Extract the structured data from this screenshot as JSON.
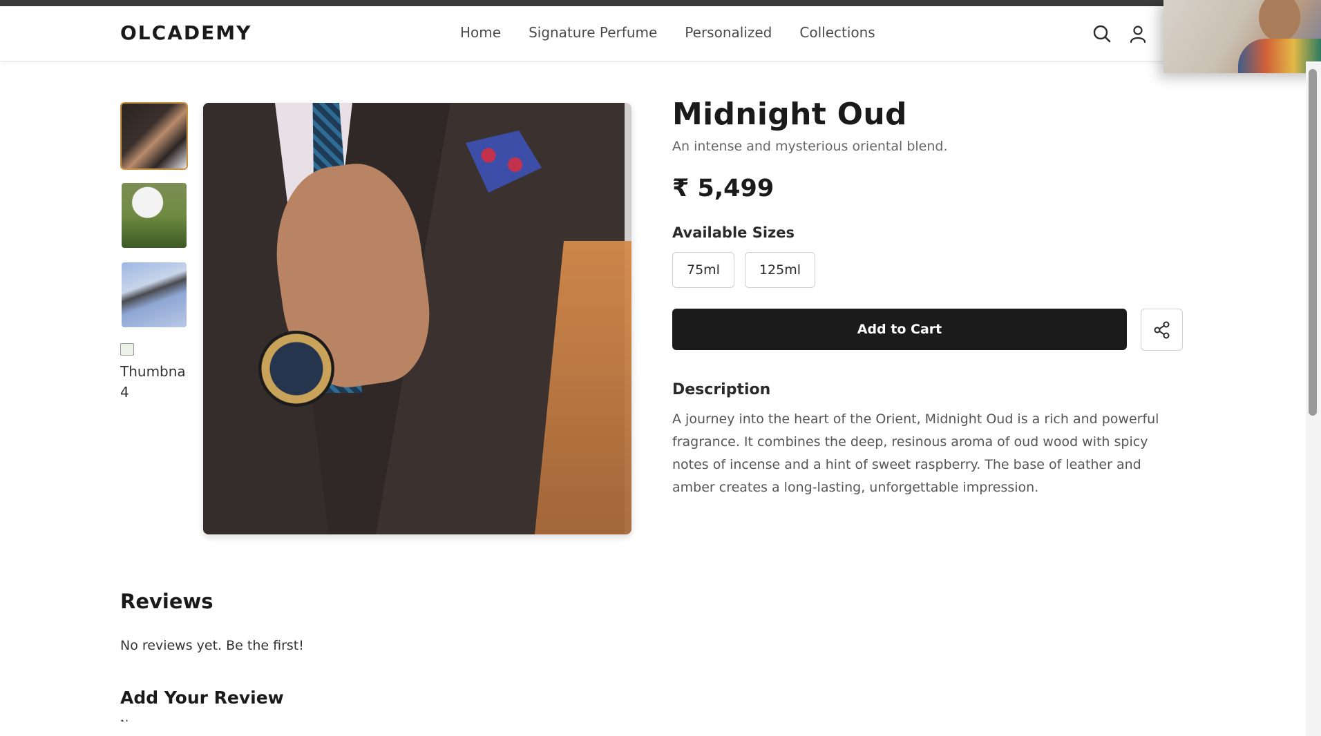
{
  "header": {
    "logo": "OLCADEMY",
    "nav": [
      "Home",
      "Signature Perfume",
      "Personalized",
      "Collections"
    ],
    "icons": [
      "search-icon",
      "user-icon"
    ]
  },
  "gallery": {
    "thumbnails": [
      "thumbnail-1",
      "thumbnail-2",
      "thumbnail-3"
    ],
    "broken_thumbnail_alt": "Thumbna 4"
  },
  "product": {
    "name": "Midnight Oud",
    "tagline": "An intense and mysterious oriental blend.",
    "price": "₹ 5,499",
    "sizes_label": "Available Sizes",
    "sizes": [
      "75ml",
      "125ml"
    ],
    "add_to_cart": "Add to Cart",
    "description_title": "Description",
    "description": "A journey into the heart of the Orient, Midnight Oud is a rich and powerful fragrance. It combines the deep, resinous aroma of oud wood with spicy notes of incense and a hint of sweet raspberry. The base of leather and amber creates a long-lasting, unforgettable impression."
  },
  "reviews": {
    "title": "Reviews",
    "empty_text": "No reviews yet. Be the first!",
    "add_title": "Add Your Review",
    "name_label": "Name"
  },
  "colors": {
    "accent_border": "#c8923f",
    "button_dark": "#1b1b1b"
  }
}
